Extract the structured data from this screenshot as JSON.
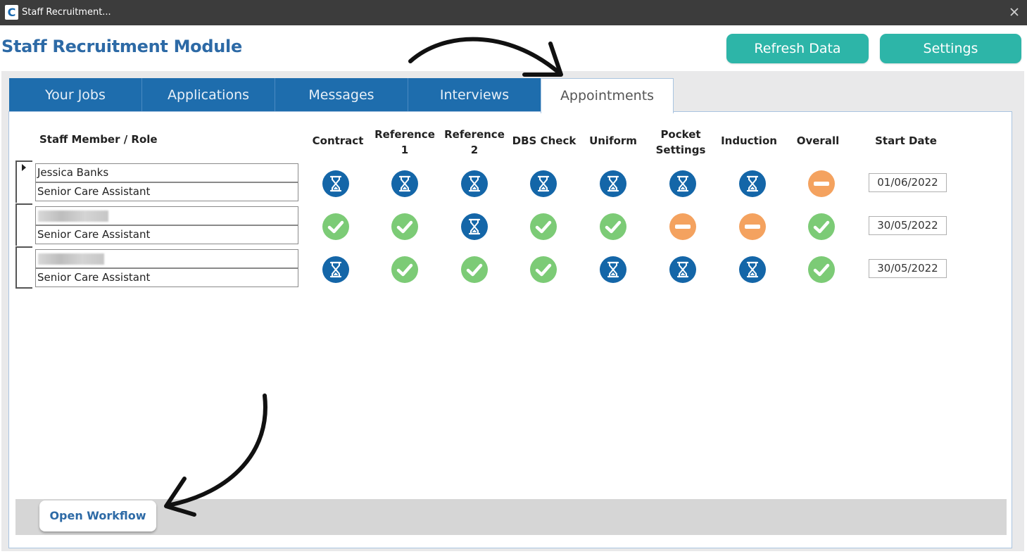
{
  "window": {
    "logo_letter": "C",
    "title": "Staff Recruitment..."
  },
  "header": {
    "title": "Staff Recruitment Module",
    "refresh_label": "Refresh Data",
    "settings_label": "Settings"
  },
  "tabs": [
    {
      "label": "Your Jobs",
      "active": false
    },
    {
      "label": "Applications",
      "active": false
    },
    {
      "label": "Messages",
      "active": false
    },
    {
      "label": "Interviews",
      "active": false
    },
    {
      "label": "Appointments",
      "active": true
    }
  ],
  "table": {
    "staff_header": "Staff Member / Role",
    "columns": [
      {
        "line1": "Contract",
        "line2": ""
      },
      {
        "line1": "Reference",
        "line2": "1"
      },
      {
        "line1": "Reference",
        "line2": "2"
      },
      {
        "line1": "DBS Check",
        "line2": ""
      },
      {
        "line1": "Uniform",
        "line2": ""
      },
      {
        "line1": "Pocket",
        "line2": "Settings"
      },
      {
        "line1": "Induction",
        "line2": ""
      },
      {
        "line1": "Overall",
        "line2": ""
      },
      {
        "line1": "Start Date",
        "line2": ""
      }
    ],
    "rows": [
      {
        "name": "Jessica Banks",
        "role": "Senior Care Assistant",
        "statuses": [
          "pending",
          "pending",
          "pending",
          "pending",
          "pending",
          "pending",
          "pending",
          "blocked"
        ],
        "start_date": "01/06/2022"
      },
      {
        "name": "",
        "role": "Senior Care Assistant",
        "statuses": [
          "complete",
          "complete",
          "pending",
          "complete",
          "complete",
          "blocked",
          "blocked",
          "complete"
        ],
        "start_date": "30/05/2022"
      },
      {
        "name": "",
        "role": "Senior Care Assistant",
        "statuses": [
          "pending",
          "complete",
          "complete",
          "complete",
          "pending",
          "pending",
          "pending",
          "complete"
        ],
        "start_date": "30/05/2022"
      }
    ]
  },
  "footer": {
    "open_workflow_label": "Open Workflow"
  },
  "icons": {
    "pending": "hourglass-icon",
    "complete": "check-circle-icon",
    "blocked": "minus-circle-icon"
  },
  "colors": {
    "titlebar": "#3c3c3c",
    "brand_blue": "#1e6dad",
    "teal_button": "#2db5a8",
    "pending_blue": "#1466a8",
    "complete_green": "#7ccb76",
    "blocked_orange": "#f4a25f"
  }
}
